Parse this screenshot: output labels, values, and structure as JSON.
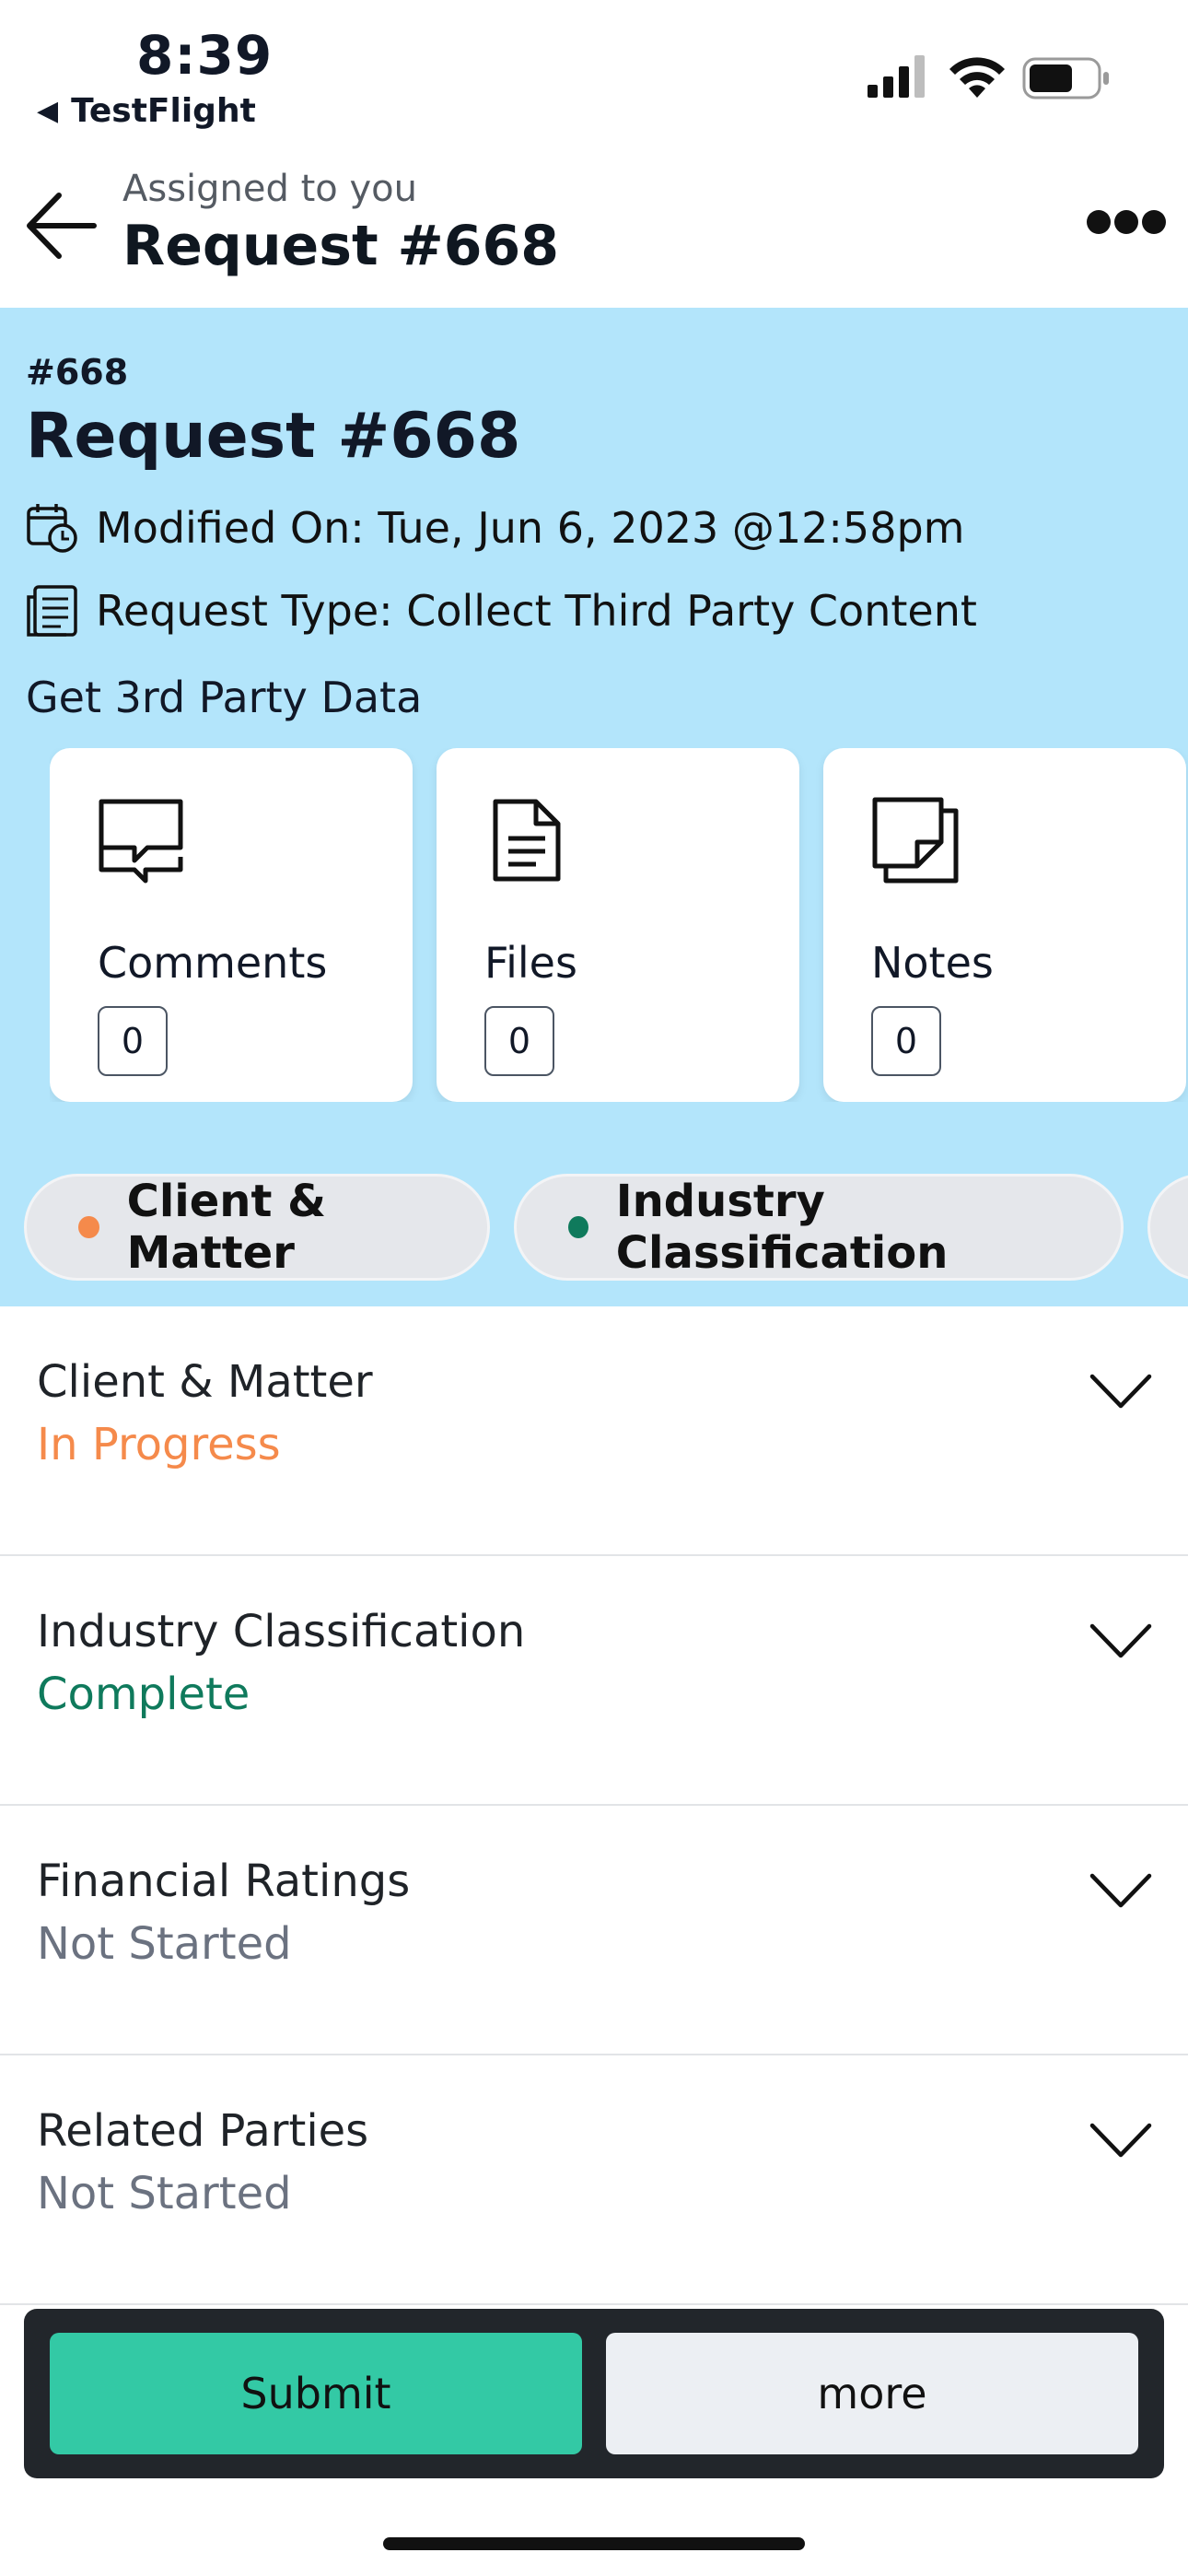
{
  "status_bar": {
    "time": "8:39",
    "back_app": "TestFlight",
    "back_glyph": "◀"
  },
  "header": {
    "subtitle": "Assigned to you",
    "title": "Request #668"
  },
  "banner": {
    "request_number": "#668",
    "request_title": "Request #668",
    "modified": "Modified On: Tue, Jun 6, 2023 @12:58pm",
    "request_type": "Request Type: Collect Third Party Content",
    "description": "Get 3rd Party Data",
    "background_color": "#b3e5fb"
  },
  "cards": [
    {
      "label": "Comments",
      "count": "0",
      "icon": "comments-icon"
    },
    {
      "label": "Files",
      "count": "0",
      "icon": "file-icon"
    },
    {
      "label": "Notes",
      "count": "0",
      "icon": "notes-icon"
    }
  ],
  "chips": [
    {
      "label": "Client & Matter",
      "dot_color": "#f58a4b"
    },
    {
      "label": "Industry Classification",
      "dot_color": "#0f7a5c"
    }
  ],
  "sections": [
    {
      "title": "Client & Matter",
      "status": "In Progress",
      "status_color": "#f58a4b"
    },
    {
      "title": "Industry Classification",
      "status": "Complete",
      "status_color": "#0f7a5c"
    },
    {
      "title": "Financial Ratings",
      "status": "Not Started",
      "status_color": "#6b7280"
    },
    {
      "title": "Related Parties",
      "status": "Not Started",
      "status_color": "#6b7280"
    }
  ],
  "footer": {
    "submit_label": "Submit",
    "more_label": "more",
    "submit_color": "#33c9a5"
  }
}
